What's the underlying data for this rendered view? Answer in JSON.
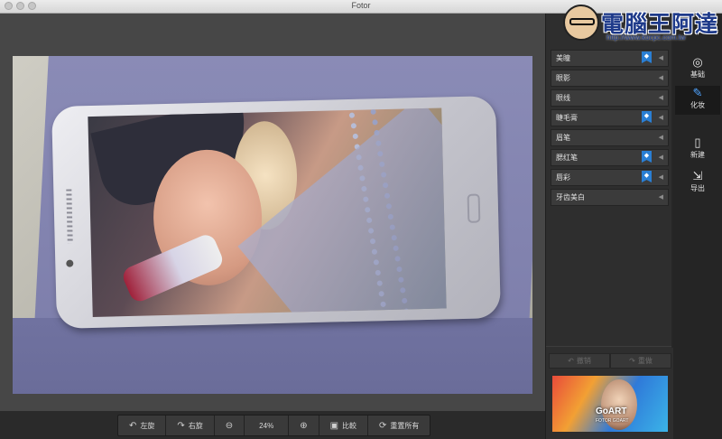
{
  "window": {
    "title": "Fotor"
  },
  "watermark": {
    "text": "電腦王阿達",
    "url": "http://www.kocpc.com.tw"
  },
  "makeup_panel": {
    "items": [
      {
        "label": "美瞳",
        "badge": true
      },
      {
        "label": "眼影",
        "badge": false
      },
      {
        "label": "眼线",
        "badge": false
      },
      {
        "label": "睫毛膏",
        "badge": true
      },
      {
        "label": "眉笔",
        "badge": false
      },
      {
        "label": "腮红笔",
        "badge": true
      },
      {
        "label": "唇彩",
        "badge": true
      },
      {
        "label": "牙齿美白",
        "badge": false
      }
    ],
    "undo_label": "撤销",
    "redo_label": "重做"
  },
  "ad": {
    "title": "GoART",
    "subtitle": "FOTOR GOART"
  },
  "nav": {
    "basic": "基础",
    "makeup": "化妆",
    "new": "新建",
    "export": "导出"
  },
  "toolbar": {
    "rotate_left": "左旋",
    "rotate_right": "右旋",
    "zoom_level": "24%",
    "compare": "比較",
    "reset_all": "重置所有"
  },
  "icons": {
    "rotate_left": "rotate-left-icon",
    "rotate_right": "rotate-right-icon",
    "zoom_out": "zoom-out-icon",
    "zoom_in": "zoom-in-icon",
    "compare": "compare-icon",
    "reset": "reset-icon"
  },
  "colors": {
    "accent_badge": "#2a7fd4",
    "panel_bg": "#2e2e2e",
    "canvas_bg": "#474747"
  }
}
